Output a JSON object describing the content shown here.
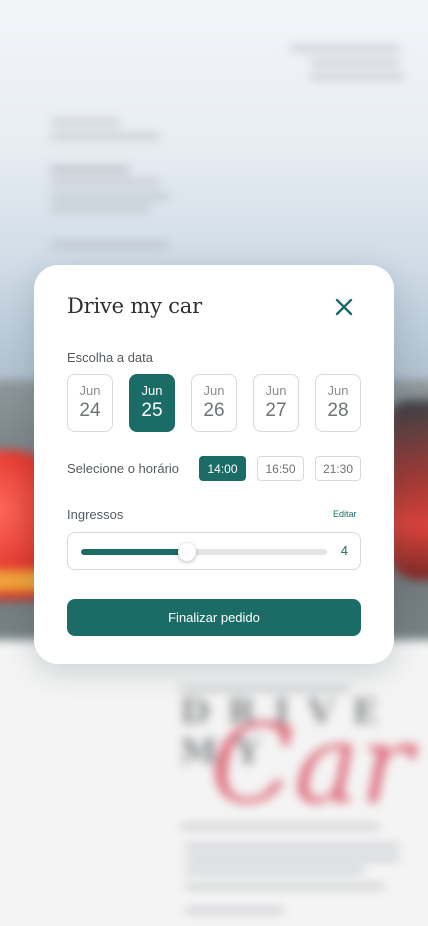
{
  "modal": {
    "title": "Drive my car",
    "close_icon": "close-icon"
  },
  "date_section": {
    "label": "Escolha a data",
    "dates": [
      {
        "month": "Jun",
        "day": "24",
        "selected": false
      },
      {
        "month": "Jun",
        "day": "25",
        "selected": true
      },
      {
        "month": "Jun",
        "day": "26",
        "selected": false
      },
      {
        "month": "Jun",
        "day": "27",
        "selected": false
      },
      {
        "month": "Jun",
        "day": "28",
        "selected": false
      }
    ]
  },
  "time_section": {
    "label": "Selecione o horário",
    "times": [
      {
        "value": "14:00",
        "selected": true
      },
      {
        "value": "16:50",
        "selected": false
      },
      {
        "value": "21:30",
        "selected": false
      }
    ]
  },
  "tickets": {
    "label": "Ingressos",
    "edit_label": "Editar",
    "count": "4",
    "slider_fraction": 0.43
  },
  "actions": {
    "finish_label": "Finalizar pedido"
  },
  "colors": {
    "accent": "#1b6c67",
    "border": "#d6dadc",
    "text": "#2d3134"
  }
}
